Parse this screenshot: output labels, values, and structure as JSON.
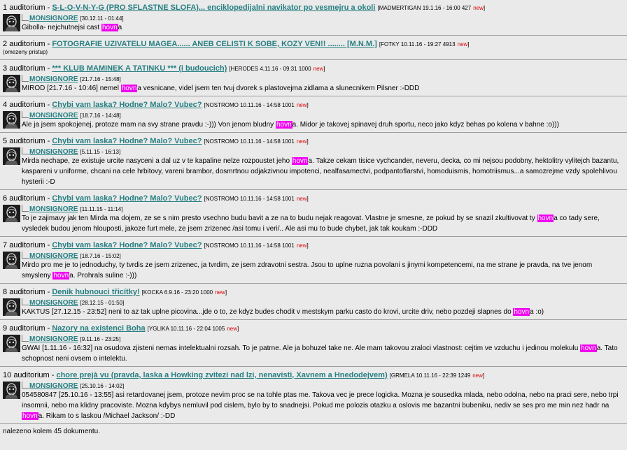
{
  "results": [
    {
      "number": "1",
      "forum": "auditorium",
      "title": "S-L-O-V-N-Y-G (PRO SFLASTNE SLOFA)... enciklopedijalni navikator po vesmejru a okoli",
      "meta": "[MADMERTIGAN 19.1.16 - 16:00 427",
      "post": {
        "author": "MONSIGNORE",
        "timestamp": "[30.12.11 - 01:44]",
        "before": "Gibolla- nejchutnejsi cast ",
        "hit": "hovn",
        "after": "a"
      }
    },
    {
      "number": "2",
      "forum": "auditorium",
      "title": "FOTOGRAFIE UZIVATELU MAGEA...... ANEB CELISTI K SOBE, KOZY VEN!! ........ [M.N.M.]",
      "meta": "[FOTKY 10.11.16 - 19:27 4913",
      "restricted": "(omezeny pristup)"
    },
    {
      "number": "3",
      "forum": "auditorium",
      "title": "*** KLUB MAMINEK A TATINKU *** (i budoucich)",
      "meta": "[HERODES 4.11.16 - 09:31 1000",
      "post": {
        "author": "MONSIGNORE",
        "timestamp": "[21.7.16 - 15:48]",
        "before": "MIROD [21.7.16 - 10:46] nemel ",
        "hit": "hovn",
        "after": "a vesnicane, videl jsem ten tvuj dvorek s plastovejma zidlama a slunecnikem Pilsner :-DDD"
      }
    },
    {
      "number": "4",
      "forum": "auditorium",
      "title": "Chybi vam laska? Hodne? Malo? Vubec?",
      "meta": "[NOSTROMO 10.11.16 - 14:58 1001",
      "post": {
        "author": "MONSIGNORE",
        "timestamp": "[18.7.16 - 14:48]",
        "before": "Ale ja jsem spokojenej, protoze mam na svy strane pravdu :-))) Von jenom bludny ",
        "hit": "hovn",
        "after": "a. Midor je takovej spinavej druh sportu, neco jako kdyz behas po kolena v bahne :o)))"
      }
    },
    {
      "number": "5",
      "forum": "auditorium",
      "title": "Chybi vam laska? Hodne? Malo? Vubec?",
      "meta": "[NOSTROMO 10.11.16 - 14:58 1001",
      "post": {
        "author": "MONSIGNORE",
        "timestamp": "[5.11.15 - 16:13]",
        "before": "Mirda nechape, ze existuje urcite nasyceni a dal uz v te kapaline nelze rozpoustet jeho ",
        "hit": "hovn",
        "after": "a. Takze cekam tisice vychcander, neveru, decka, co mi nejsou podobny, hektolitry vylitejch bazantu, kaspareni v uniforme, chcani na cele hrbitovy, vareni brambor, dosmrtnou odjakzivnou impotenci, nealfasamectvi, podpantoflarstvi, homoduismis, homotriismus...a samozrejme vzdy spolehlivou hysterii :-D"
      }
    },
    {
      "number": "6",
      "forum": "auditorium",
      "title": "Chybi vam laska? Hodne? Malo? Vubec?",
      "meta": "[NOSTROMO 10.11.16 - 14:58 1001",
      "post": {
        "author": "MONSIGNORE",
        "timestamp": "[11.11.15 - 11:14]",
        "before": "To je zajimavy jak ten Mirda ma dojem, ze se s nim presto vsechno budu bavit a ze na to budu nejak reagovat. Vlastne je smesne, ze pokud by se snazil zkultivovat ty ",
        "hit": "hovn",
        "after": "a co tady sere, vysledek budou jenom hlouposti, jakoze furt mele, ze jsem zrizenec /asi tomu i veri/.. Ale asi mu to bude chybet, jak tak koukam :-DDD"
      }
    },
    {
      "number": "7",
      "forum": "auditorium",
      "title": "Chybi vam laska? Hodne? Malo? Vubec?",
      "meta": "[NOSTROMO 10.11.16 - 14:58 1001",
      "post": {
        "author": "MONSIGNORE",
        "timestamp": "[18.7.16 - 15:02]",
        "before": "Mirdo pro me je to jednoduchy, ty tvrdis ze jsem zrizenec, ja tvrdim, ze jsem zdravotni sestra. Jsou to uplne ruzna povolani s jinymi kompetencemi, na me strane je pravda, na tve jenom smysleny ",
        "hit": "hovn",
        "after": "a. Prohrals suline :-)))"
      }
    },
    {
      "number": "8",
      "forum": "auditorium",
      "title": "Denik hubnouci třicítky!",
      "meta": "[KOCKA 6.9.16 - 23:20 1000",
      "post": {
        "author": "MONSIGNORE",
        "timestamp": "[28.12.15 - 01:50]",
        "before": "KAKTUS [27.12.15 - 23:52] neni to az tak uplne picovina...jde o to, ze kdyz budes chodit v mestskym parku casto do krovi, urcite driv, nebo pozdeji slapnes do ",
        "hit": "hovn",
        "after": "a :o)"
      }
    },
    {
      "number": "9",
      "forum": "auditorium",
      "title": "Nazory na existenci Boha",
      "meta": "[YGLIKA 10.11.16 - 22:04 1005",
      "post": {
        "author": "MONSIGNORE",
        "timestamp": "[9.11.16 - 23:25]",
        "before": "GWAI [1.11.16 - 16:32] na osudova zjisteni nemas intelektualni rozsah. To je patrne. Ale ja bohuzel take ne. Ale mam takovou zraloci vlastnost: cejtim ve vzduchu i jedinou molekulu ",
        "hit": "hovn",
        "after": "a. Tato schopnost neni ovsem o intelektu."
      }
    },
    {
      "number": "10",
      "forum": "auditorium",
      "title": "chore prejà vu (pravda, laska a Howking zvitezi nad lzi, nenavisti, Xavnem a Hnedodejvem)",
      "meta": "[GRMELA 10.11.16 - 22:39 1249",
      "post": {
        "author": "MONSIGNORE",
        "timestamp": "[25.10.16 - 14:02]",
        "before": "054580847 [25.10.16 - 13:55] asi retardovanej jsem, protoze nevim proc se na tohle ptas me. Takova vec je prece logicka. Mozna je sousedka mlada, nebo odolna, nebo na praci sere, nebo trpi insomnii, nebo ma klidny pracoviste. Mozna kdybys nemluvil pod cislem, bylo by to snadnejsi. Pokud me polozis otazku a oslovis me bazantni bubeniku, nediv se ses pro me min nez hadr na ",
        "hit": "hovn",
        "after": "a. Rikam to s laskou /Michael Jackson/ :-DD"
      }
    }
  ],
  "new_label": "new",
  "meta_close": "]",
  "footer": "nalezeno kolem 45 dokumentu.",
  "colors": {
    "link": "#267f82",
    "highlight": "#f000f0",
    "new": "#e00000",
    "background": "#eaeaea"
  },
  "icons": {
    "avatar": "avatar-icon",
    "reply": "reply-icon"
  }
}
